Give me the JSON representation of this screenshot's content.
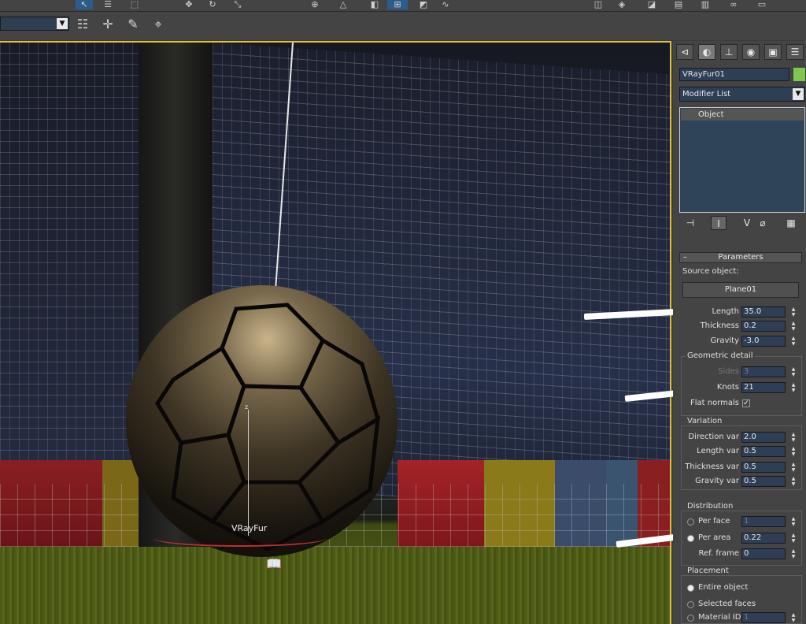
{
  "object_name": "VRayFur01",
  "object_color": "#7ec850",
  "modifier_list": "Modifier List",
  "stack_item": "Object",
  "viewport": {
    "gizmo_label": "VRayFur",
    "axis_label": "z"
  },
  "parameters": {
    "title": "Parameters",
    "collapse": "–",
    "source_object_label": "Source object:",
    "source_object_button": "Plane01",
    "length_label": "Length",
    "length_value": "35.0",
    "thickness_label": "Thickness",
    "thickness_value": "0.2",
    "gravity_label": "Gravity",
    "gravity_value": "-3.0"
  },
  "geometric_detail": {
    "title": "Geometric detail",
    "sides_label": "Sides",
    "sides_value": "3",
    "knots_label": "Knots",
    "knots_value": "21",
    "flat_normals_label": "Flat normals",
    "flat_normals_checked": "✓"
  },
  "variation": {
    "title": "Variation",
    "direction_label": "Direction var",
    "direction_value": "2.0",
    "length_label": "Length var",
    "length_value": "0.5",
    "thickness_label": "Thickness var",
    "thickness_value": "0.5",
    "gravity_label": "Gravity var",
    "gravity_value": "0.5"
  },
  "distribution": {
    "title": "Distribution",
    "per_face_label": "Per face",
    "per_face_value": "1",
    "per_area_label": "Per area",
    "per_area_value": "0.22",
    "ref_frame_label": "Ref. frame",
    "ref_frame_value": "0"
  },
  "placement": {
    "title": "Placement",
    "entire_label": "Entire object",
    "selected_label": "Selected faces",
    "material_label": "Material ID",
    "material_value": "1"
  },
  "colors": {
    "viewport_border": "#e0c23a",
    "field_bg": "#2d3e55",
    "panel_bg": "#444444"
  }
}
